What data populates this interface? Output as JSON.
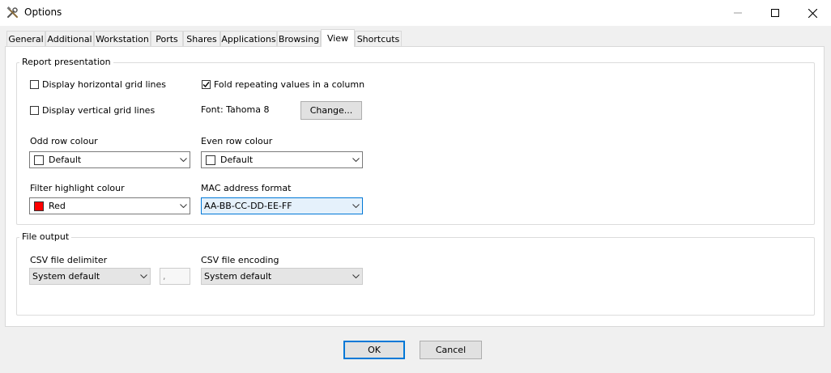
{
  "window": {
    "title": "Options",
    "app_icon": "tools-icon"
  },
  "tabs": [
    {
      "label": "General"
    },
    {
      "label": "Additional"
    },
    {
      "label": "Workstation"
    },
    {
      "label": "Ports"
    },
    {
      "label": "Shares"
    },
    {
      "label": "Applications"
    },
    {
      "label": "Browsing"
    },
    {
      "label": "View",
      "active": true
    },
    {
      "label": "Shortcuts"
    }
  ],
  "report": {
    "group_label": "Report presentation",
    "h_grid": {
      "label": "Display horizontal grid lines",
      "checked": false
    },
    "v_grid": {
      "label": "Display vertical grid lines",
      "checked": false
    },
    "fold": {
      "label": "Fold repeating values in a column",
      "checked": true
    },
    "font_label": "Font: Tahoma 8",
    "change_button": "Change...",
    "odd_row": {
      "label": "Odd row colour",
      "value": "Default",
      "color": "#ffffff"
    },
    "even_row": {
      "label": "Even row colour",
      "value": "Default",
      "color": "#ffffff"
    },
    "filter_highlight": {
      "label": "Filter highlight colour",
      "value": "Red",
      "color": "#ff0000"
    },
    "mac_format": {
      "label": "MAC address format",
      "value": "AA-BB-CC-DD-EE-FF"
    }
  },
  "file_output": {
    "group_label": "File output",
    "csv_delimiter": {
      "label": "CSV file delimiter",
      "value": "System default",
      "char": ","
    },
    "csv_encoding": {
      "label": "CSV file encoding",
      "value": "System default"
    }
  },
  "footer": {
    "ok": "OK",
    "cancel": "Cancel"
  },
  "colors": {
    "accent": "#0078d7"
  }
}
